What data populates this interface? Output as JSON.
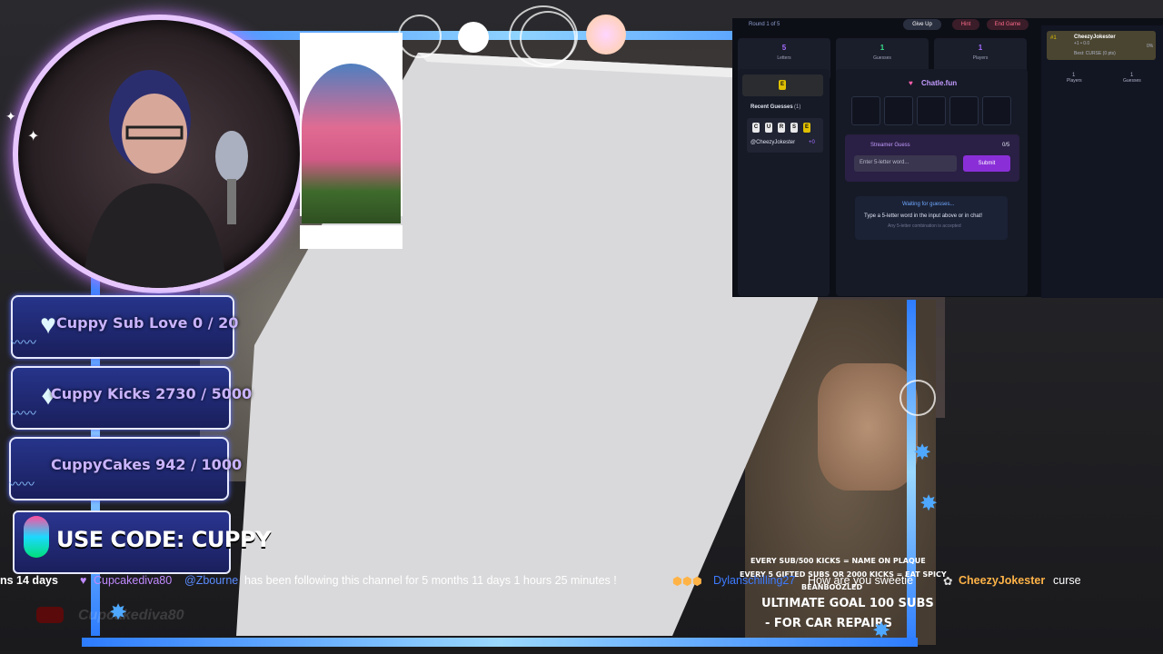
{
  "goals": {
    "sub": "Cuppy Sub Love 0 / 20",
    "kicks": "Cuppy Kicks 2730 / 5000",
    "cakes": "CuppyCakes  942 / 1000",
    "code": "USE CODE: CUPPY"
  },
  "game": {
    "round": "Round 1 of 5",
    "give_up": "Give Up",
    "hint": "Hint",
    "end_game": "End Game",
    "stats": [
      {
        "num": "5",
        "label": "Letters"
      },
      {
        "num": "1",
        "label": "Guesses"
      },
      {
        "num": "1",
        "label": "Players"
      }
    ],
    "revealed_letter": "E",
    "recent_guesses_label": "Recent Guesses",
    "recent_guesses_count": "(1)",
    "guess_letters": [
      "C",
      "U",
      "R",
      "S",
      "E"
    ],
    "guess_user": "@CheezyJokester",
    "guess_points": "+0",
    "brand": "Chatle.fun",
    "streamer_guess_label": "Streamer Guess",
    "streamer_guess_count": "0/5",
    "input_placeholder": "Enter 5-letter word...",
    "submit": "Submit",
    "waiting": "Waiting for guesses...",
    "waiting_hint": "Type a 5-letter word in the input above or in chat!",
    "waiting_sub": "Any 5-letter combination is accepted",
    "leader_rank": "#1",
    "leader_name": "CheezyJokester",
    "leader_points": "+1 • 0.0",
    "leader_best": "Best: CURSE (0 pts)",
    "leader_pct": "0%",
    "right_players": "1",
    "right_players_label": "Players",
    "right_guesses": "1",
    "right_guesses_label": "Guesses"
  },
  "ticker": {
    "prefix": "ns 14 days",
    "follower_name": "Cupcakediva80",
    "follower_mention": "@Zbourne",
    "follower_msg": "has been following this channel for 5 months 11 days 1 hours 25 minutes !",
    "chat_user1": "Dylanschilling27",
    "chat_msg1": "How are you sweetie",
    "chat_user2": "CheezyJokester",
    "chat_msg2": "curse"
  },
  "plaque": {
    "line1": "EVERY SUB/500 KICKS = NAME ON PLAQUE",
    "line2": "EVERY 5 GIFTED SUBS OR 2000 KICKS = EAT SPICY",
    "line3": "BEANBOOZLED",
    "ultimate1": "ULTIMATE GOAL 100 SUBS",
    "ultimate2": "- FOR CAR REPAIRS"
  },
  "overlay_name": "Cupcakediva80",
  "colors": {
    "accent": "#a66cff",
    "frame": "#2d7cff",
    "hint": "#e0c000"
  }
}
